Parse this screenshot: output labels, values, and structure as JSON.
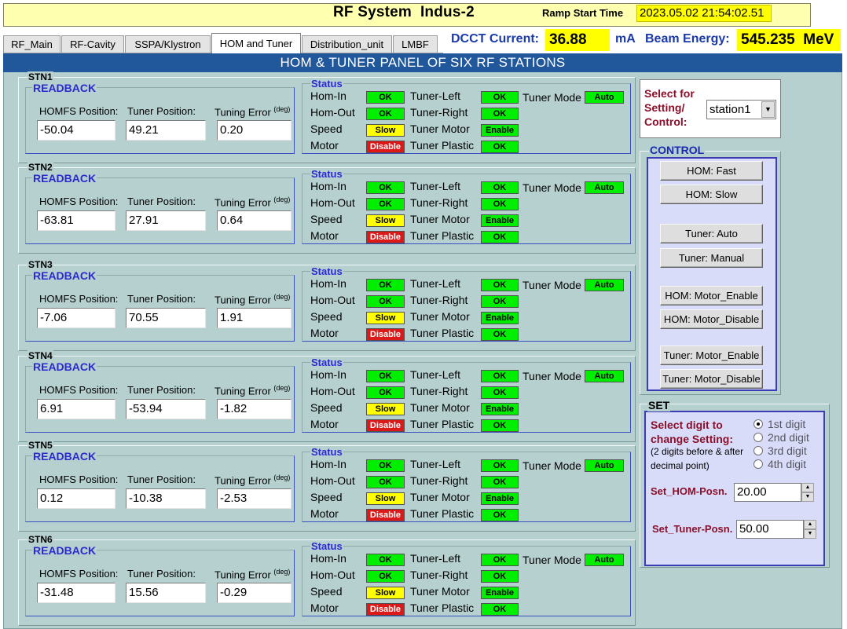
{
  "header": {
    "title": "RF System  Indus-2",
    "ramp_label": "Ramp Start Time",
    "ramp_value": "2023.05.02 21:54:02.51"
  },
  "tabs": [
    "RF_Main",
    "RF-Cavity",
    "SSPA/Klystron",
    "HOM and Tuner",
    "Distribution_unit",
    "LMBF"
  ],
  "active_tab": "HOM and Tuner",
  "status_bar": {
    "dcct_label": "DCCT Current:",
    "dcct_value": "36.88",
    "dcct_unit": "mA",
    "energy_label": "Beam Energy:",
    "energy_value": "545.235",
    "energy_unit": "MeV"
  },
  "panel_title": "HOM & TUNER PANEL OF SIX RF STATIONS",
  "labels": {
    "readback": "READBACK",
    "homfs": "HOMFS Position:",
    "tuner": "Tuner Position:",
    "tuning_error": "Tuning Error",
    "deg": "(deg)",
    "status": "Status",
    "hom_in": "Hom-In",
    "hom_out": "Hom-Out",
    "speed": "Speed",
    "motor": "Motor",
    "tuner_left": "Tuner-Left",
    "tuner_right": "Tuner-Right",
    "tuner_motor": "Tuner Motor",
    "tuner_plastic": "Tuner Plastic",
    "tuner_mode": "Tuner Mode"
  },
  "stations": [
    {
      "name": "STN1",
      "homfs": "-50.04",
      "tuner": "49.21",
      "error": "0.20",
      "hom_in": "OK",
      "hom_out": "OK",
      "speed": "Slow",
      "motor": "Disable",
      "tuner_left": "OK",
      "tuner_right": "OK",
      "tuner_motor": "Enable",
      "tuner_plastic": "OK",
      "tuner_mode": "Auto"
    },
    {
      "name": "STN2",
      "homfs": "-63.81",
      "tuner": "27.91",
      "error": "0.64",
      "hom_in": "OK",
      "hom_out": "OK",
      "speed": "Slow",
      "motor": "Disable",
      "tuner_left": "OK",
      "tuner_right": "OK",
      "tuner_motor": "Enable",
      "tuner_plastic": "OK",
      "tuner_mode": "Auto"
    },
    {
      "name": "STN3",
      "homfs": "-7.06",
      "tuner": "70.55",
      "error": "1.91",
      "hom_in": "OK",
      "hom_out": "OK",
      "speed": "Slow",
      "motor": "Disable",
      "tuner_left": "OK",
      "tuner_right": "OK",
      "tuner_motor": "Enable",
      "tuner_plastic": "OK",
      "tuner_mode": "Auto"
    },
    {
      "name": "STN4",
      "homfs": "6.91",
      "tuner": "-53.94",
      "error": "-1.82",
      "hom_in": "OK",
      "hom_out": "OK",
      "speed": "Slow",
      "motor": "Disable",
      "tuner_left": "OK",
      "tuner_right": "OK",
      "tuner_motor": "Enable",
      "tuner_plastic": "OK",
      "tuner_mode": "Auto"
    },
    {
      "name": "STN5",
      "homfs": "0.12",
      "tuner": "-10.38",
      "error": "-2.53",
      "hom_in": "OK",
      "hom_out": "OK",
      "speed": "Slow",
      "motor": "Disable",
      "tuner_left": "OK",
      "tuner_right": "OK",
      "tuner_motor": "Enable",
      "tuner_plastic": "OK",
      "tuner_mode": "Auto"
    },
    {
      "name": "STN6",
      "homfs": "-31.48",
      "tuner": "15.56",
      "error": "-0.29",
      "hom_in": "OK",
      "hom_out": "OK",
      "speed": "Slow",
      "motor": "Disable",
      "tuner_left": "OK",
      "tuner_right": "OK",
      "tuner_motor": "Enable",
      "tuner_plastic": "OK",
      "tuner_mode": "Auto"
    }
  ],
  "select": {
    "label": "Select for Setting/ Control:",
    "value": "station1"
  },
  "control": {
    "title": "CONTROL",
    "buttons": [
      "HOM: Fast",
      "HOM: Slow",
      "Tuner: Auto",
      "Tuner: Manual",
      "HOM: Motor_Enable",
      "HOM: Motor_Disable",
      "Tuner: Motor_Enable",
      "Tuner: Motor_Disable"
    ]
  },
  "set": {
    "title": "SET",
    "select_digit": "Select digit to change Setting:",
    "note": "(2 digits before & after decimal point)",
    "digits": [
      "1st digit",
      "2nd digit",
      "3rd digit",
      "4th digit"
    ],
    "selected_digit": "1st digit",
    "hom_label": "Set_HOM-Posn.",
    "hom_value": "20.00",
    "tuner_label": "Set_Tuner-Posn.",
    "tuner_value": "50.00"
  },
  "colors": {
    "ok": "#00ee00",
    "slow": "#ffff00",
    "disable": "#dd1818",
    "panel_bg": "#b6d0d0",
    "panel_header": "#21579b",
    "header_yellow": "#ffff00"
  }
}
